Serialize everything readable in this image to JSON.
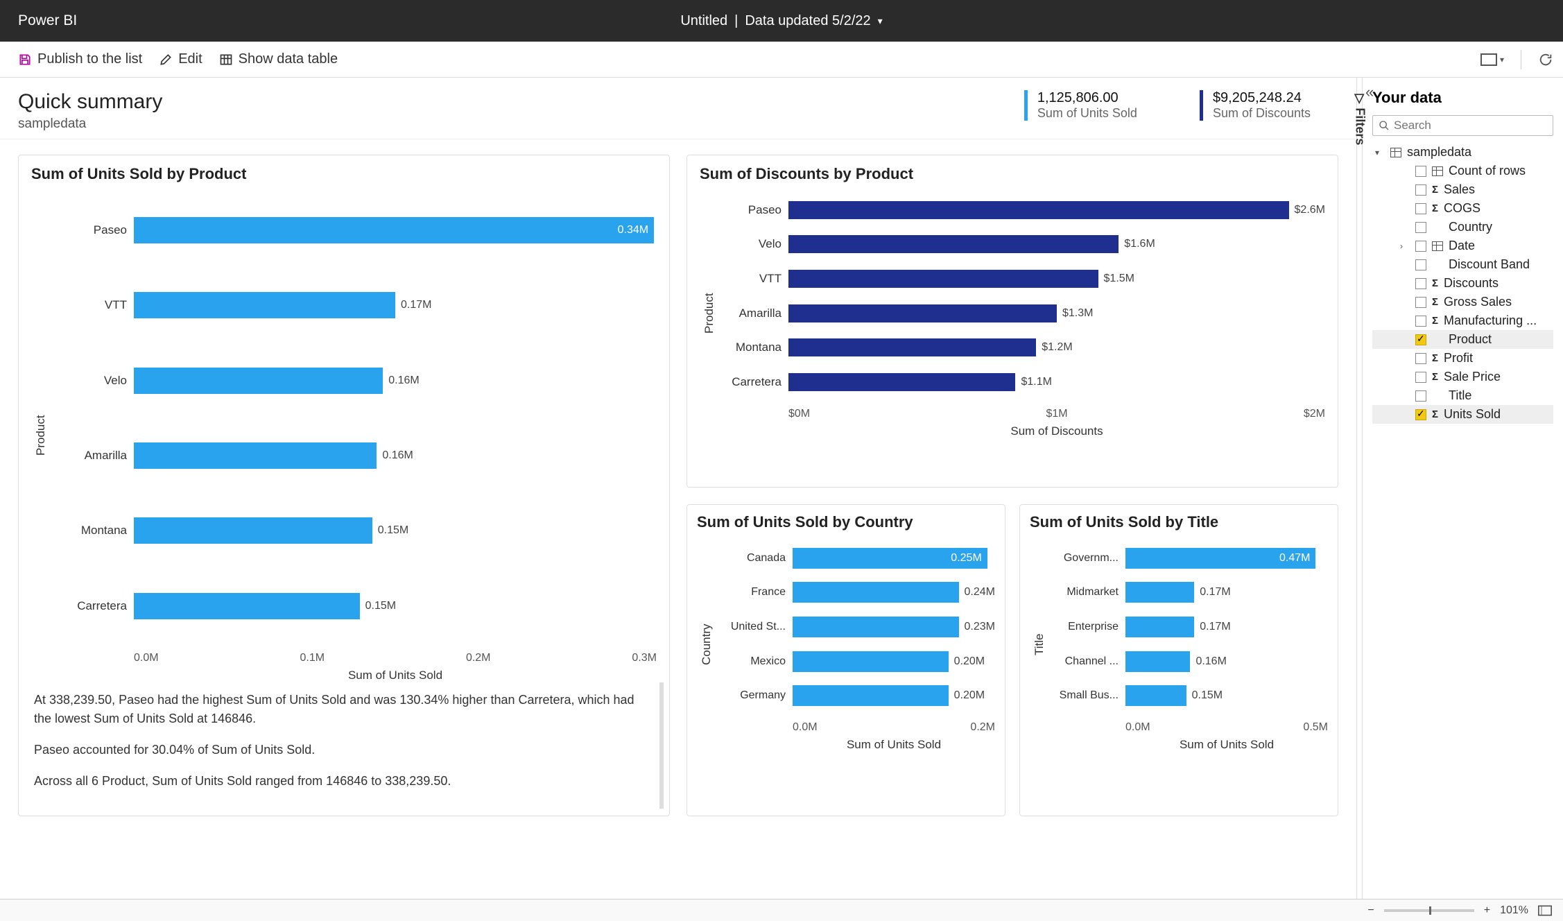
{
  "titlebar": {
    "app": "Power BI",
    "doc": "Untitled",
    "updated": "Data updated 5/2/22"
  },
  "toolbar": {
    "publish": "Publish to the list",
    "edit": "Edit",
    "show_table": "Show data table"
  },
  "header": {
    "title": "Quick summary",
    "subtitle": "sampledata",
    "kpi1_value": "1,125,806.00",
    "kpi1_label": "Sum of Units Sold",
    "kpi2_value": "$9,205,248.24",
    "kpi2_label": "Sum of Discounts"
  },
  "filters_label": "Filters",
  "your_data": {
    "title": "Your data",
    "search_placeholder": "Search",
    "table": "sampledata",
    "fields": [
      {
        "label": "Count of rows",
        "type": "table",
        "checked": false
      },
      {
        "label": "Sales",
        "type": "sigma",
        "checked": false
      },
      {
        "label": "COGS",
        "type": "sigma",
        "checked": false
      },
      {
        "label": "Country",
        "type": "none",
        "checked": false
      },
      {
        "label": "Date",
        "type": "table",
        "checked": false,
        "expandable": true
      },
      {
        "label": "Discount Band",
        "type": "none",
        "checked": false
      },
      {
        "label": "Discounts",
        "type": "sigma",
        "checked": false
      },
      {
        "label": "Gross Sales",
        "type": "sigma",
        "checked": false
      },
      {
        "label": "Manufacturing ...",
        "type": "sigma",
        "checked": false
      },
      {
        "label": "Product",
        "type": "none",
        "checked": true,
        "selected": true
      },
      {
        "label": "Profit",
        "type": "sigma",
        "checked": false
      },
      {
        "label": "Sale Price",
        "type": "sigma",
        "checked": false
      },
      {
        "label": "Title",
        "type": "none",
        "checked": false
      },
      {
        "label": "Units Sold",
        "type": "sigma",
        "checked": true,
        "selected": true
      }
    ]
  },
  "statusbar": {
    "zoom": "101%"
  },
  "insights": {
    "p1": "At 338,239.50, Paseo had the highest Sum of Units Sold and was 130.34% higher than Carretera, which had the lowest Sum of Units Sold at 146846.",
    "p2": "Paseo accounted for 30.04% of Sum of Units Sold.",
    "p3": "Across all 6 Product, Sum of Units Sold ranged from 146846 to 338,239.50."
  },
  "chart_data": [
    {
      "id": "units_by_product",
      "type": "bar",
      "orientation": "horizontal",
      "title": "Sum of Units Sold by Product",
      "ylabel": "Product",
      "xlabel": "Sum of Units Sold",
      "color": "#2aa3ef",
      "xticks": [
        "0.0M",
        "0.1M",
        "0.2M",
        "0.3M"
      ],
      "xmax": 340000,
      "categories": [
        "Paseo",
        "VTT",
        "Velo",
        "Amarilla",
        "Montana",
        "Carretera"
      ],
      "values": [
        338239.5,
        170000,
        162000,
        158000,
        155000,
        146846
      ],
      "value_labels": [
        "0.34M",
        "0.17M",
        "0.16M",
        "0.16M",
        "0.15M",
        "0.15M"
      ],
      "label_inside": [
        true,
        false,
        false,
        false,
        false,
        false
      ]
    },
    {
      "id": "discounts_by_product",
      "type": "bar",
      "orientation": "horizontal",
      "title": "Sum of Discounts by Product",
      "ylabel": "Product",
      "xlabel": "Sum of Discounts",
      "color": "#1e2f8f",
      "xticks": [
        "$0M",
        "$1M",
        "$2M"
      ],
      "xmax": 2600000,
      "categories": [
        "Paseo",
        "Velo",
        "VTT",
        "Amarilla",
        "Montana",
        "Carretera"
      ],
      "values": [
        2600000,
        1600000,
        1500000,
        1300000,
        1200000,
        1100000
      ],
      "value_labels": [
        "$2.6M",
        "$1.6M",
        "$1.5M",
        "$1.3M",
        "$1.2M",
        "$1.1M"
      ],
      "label_inside": [
        false,
        false,
        false,
        false,
        false,
        false
      ]
    },
    {
      "id": "units_by_country",
      "type": "bar",
      "orientation": "horizontal",
      "title": "Sum of Units Sold by Country",
      "ylabel": "Country",
      "xlabel": "Sum of Units Sold",
      "color": "#2aa3ef",
      "xticks": [
        "0.0M",
        "0.2M"
      ],
      "xmax": 260000,
      "categories": [
        "Canada",
        "France",
        "United St...",
        "Mexico",
        "Germany"
      ],
      "values": [
        250000,
        240000,
        230000,
        200000,
        200000
      ],
      "value_labels": [
        "0.25M",
        "0.24M",
        "0.23M",
        "0.20M",
        "0.20M"
      ],
      "label_inside": [
        true,
        false,
        false,
        false,
        false
      ]
    },
    {
      "id": "units_by_title",
      "type": "bar",
      "orientation": "horizontal",
      "title": "Sum of Units Sold by Title",
      "ylabel": "Title",
      "xlabel": "Sum of Units Sold",
      "color": "#2aa3ef",
      "xticks": [
        "0.0M",
        "0.5M"
      ],
      "xmax": 500000,
      "categories": [
        "Governm...",
        "Midmarket",
        "Enterprise",
        "Channel ...",
        "Small Bus..."
      ],
      "values": [
        470000,
        170000,
        170000,
        160000,
        150000
      ],
      "value_labels": [
        "0.47M",
        "0.17M",
        "0.17M",
        "0.16M",
        "0.15M"
      ],
      "label_inside": [
        true,
        false,
        false,
        false,
        false
      ]
    }
  ]
}
